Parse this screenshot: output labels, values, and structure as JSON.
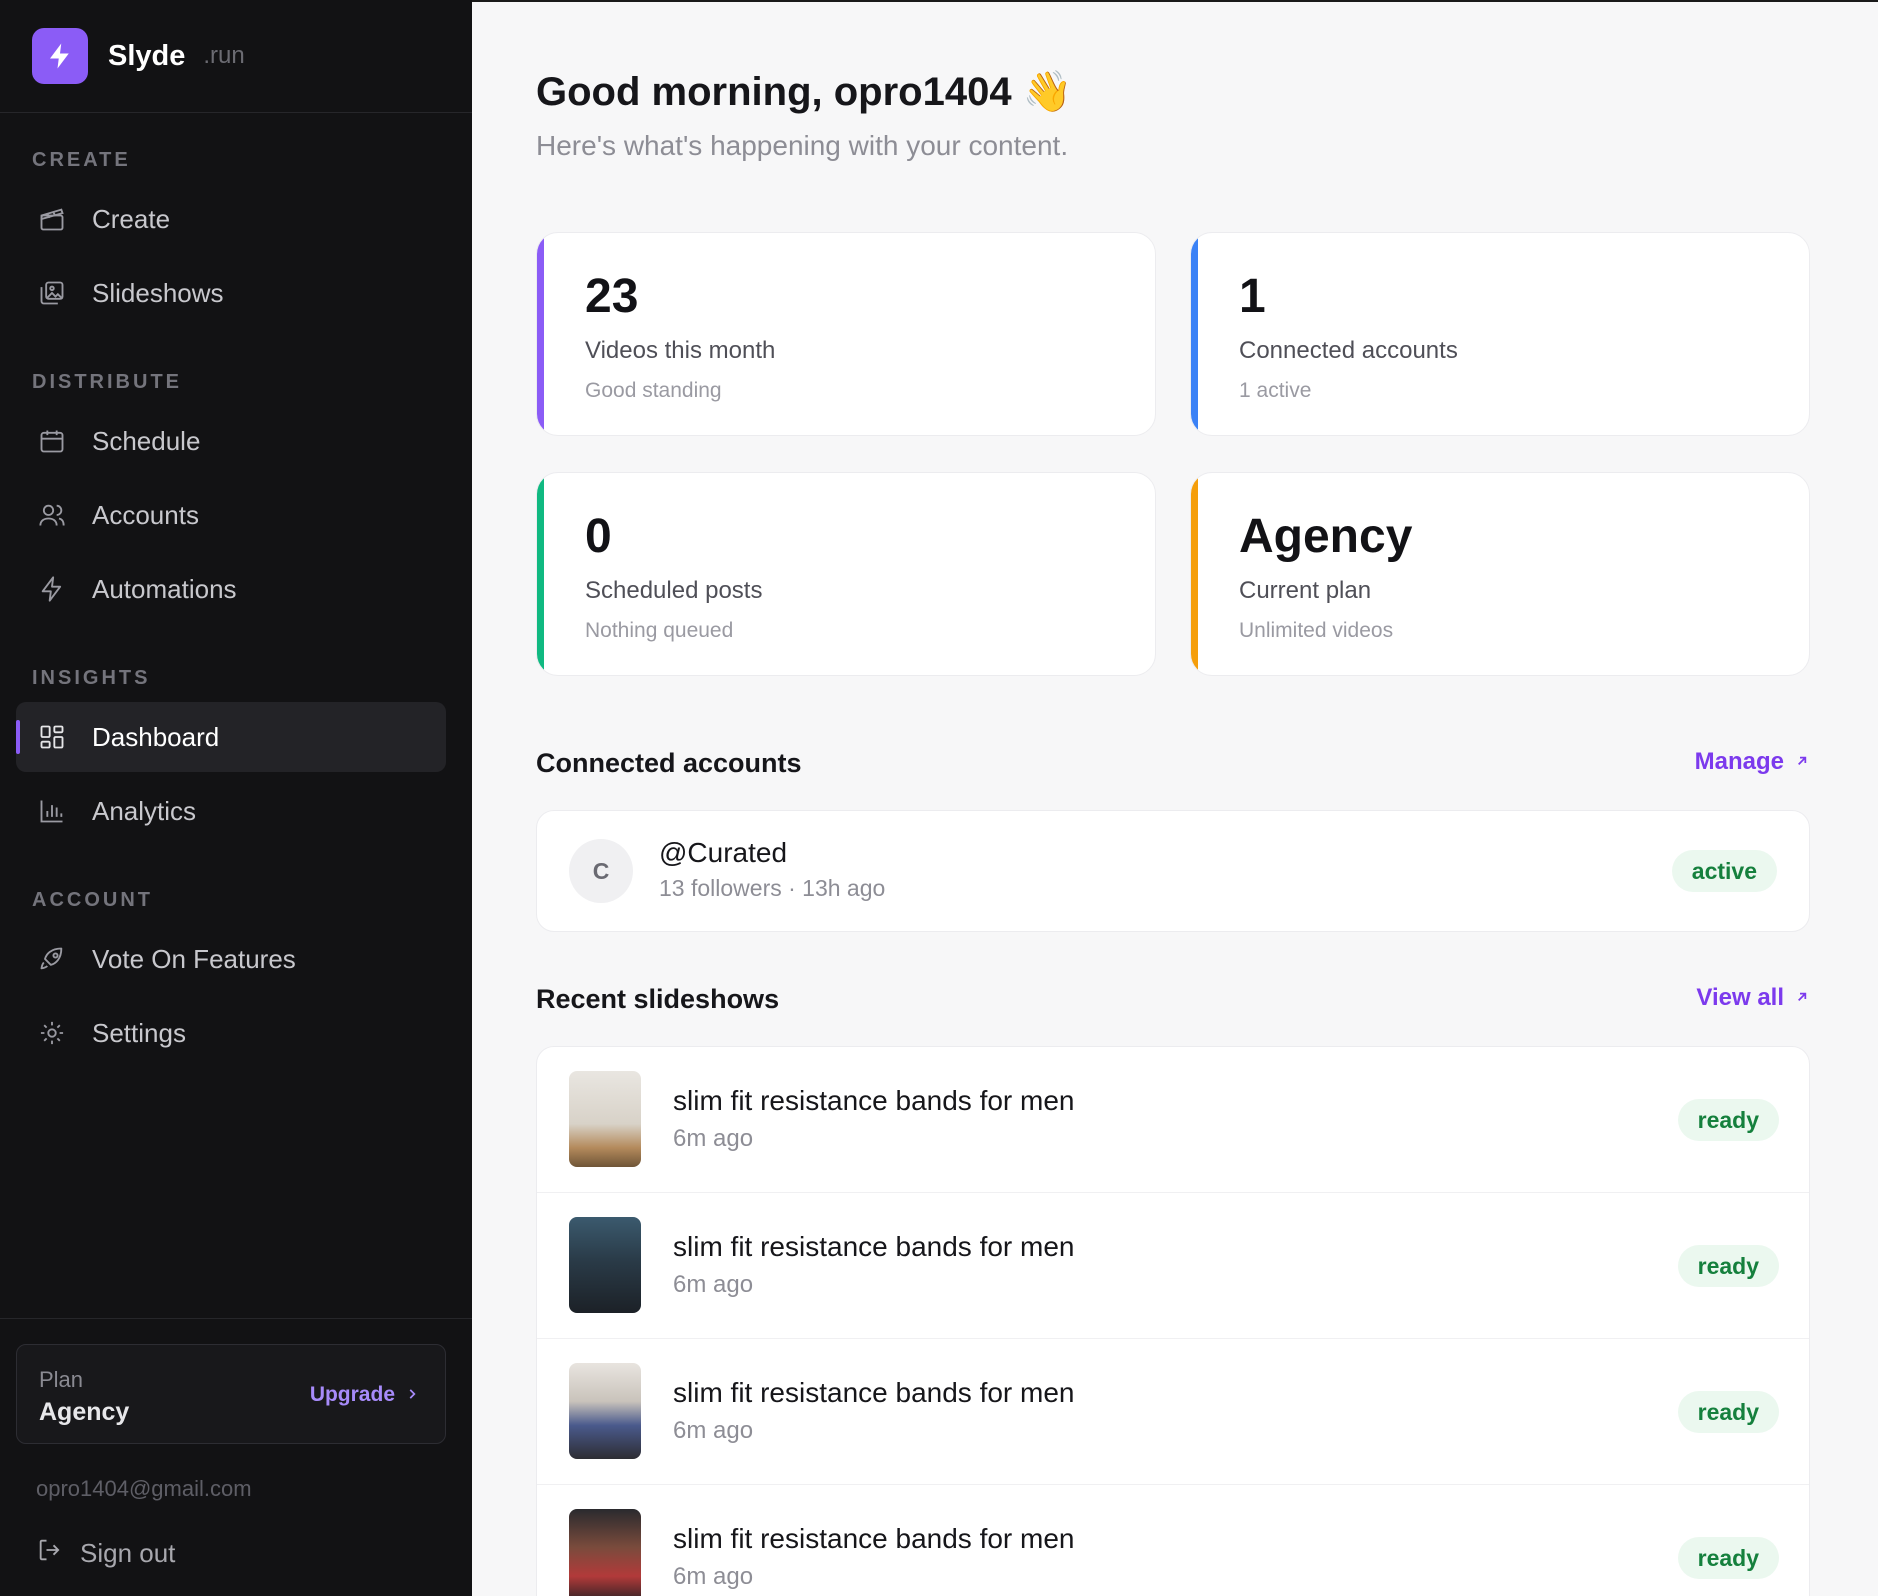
{
  "brand": {
    "name": "Slyde",
    "tld": ".run"
  },
  "sidebar": {
    "sections": [
      {
        "label": "CREATE"
      },
      {
        "label": "DISTRIBUTE"
      },
      {
        "label": "INSIGHTS"
      },
      {
        "label": "ACCOUNT"
      }
    ],
    "items": [
      {
        "label": "Create",
        "icon": "clapperboard-icon"
      },
      {
        "label": "Slideshows",
        "icon": "images-icon"
      },
      {
        "label": "Schedule",
        "icon": "calendar-icon"
      },
      {
        "label": "Accounts",
        "icon": "users-icon"
      },
      {
        "label": "Automations",
        "icon": "lightning-icon"
      },
      {
        "label": "Dashboard",
        "icon": "grid-icon",
        "active": true
      },
      {
        "label": "Analytics",
        "icon": "bar-chart-icon"
      },
      {
        "label": "Vote On Features",
        "icon": "rocket-icon"
      },
      {
        "label": "Settings",
        "icon": "gear-icon"
      }
    ],
    "plan": {
      "label": "Plan",
      "name": "Agency",
      "upgrade": "Upgrade"
    },
    "user_email": "opro1404@gmail.com",
    "signout": "Sign out"
  },
  "main": {
    "greeting": "Good morning, opro1404 👋",
    "subgreeting": "Here's what's happening with your content.",
    "stats": [
      {
        "value": "23",
        "label": "Videos this month",
        "sub": "Good standing",
        "accent": "#8b5cf6"
      },
      {
        "value": "1",
        "label": "Connected accounts",
        "sub": "1 active",
        "accent": "#3b82f6"
      },
      {
        "value": "0",
        "label": "Scheduled posts",
        "sub": "Nothing queued",
        "accent": "#10b981"
      },
      {
        "value": "Agency",
        "label": "Current plan",
        "sub": "Unlimited videos",
        "accent": "#f59e0b"
      }
    ],
    "connected": {
      "title": "Connected accounts",
      "link": "Manage",
      "account": {
        "initial": "C",
        "handle": "@Curated",
        "meta": "13 followers · 13h ago",
        "status": "active"
      }
    },
    "recent": {
      "title": "Recent slideshows",
      "link": "View all",
      "items": [
        {
          "title": "slim fit resistance bands for men",
          "time": "6m ago",
          "status": "ready"
        },
        {
          "title": "slim fit resistance bands for men",
          "time": "6m ago",
          "status": "ready"
        },
        {
          "title": "slim fit resistance bands for men",
          "time": "6m ago",
          "status": "ready"
        },
        {
          "title": "slim fit resistance bands for men",
          "time": "6m ago",
          "status": "ready"
        }
      ]
    }
  }
}
